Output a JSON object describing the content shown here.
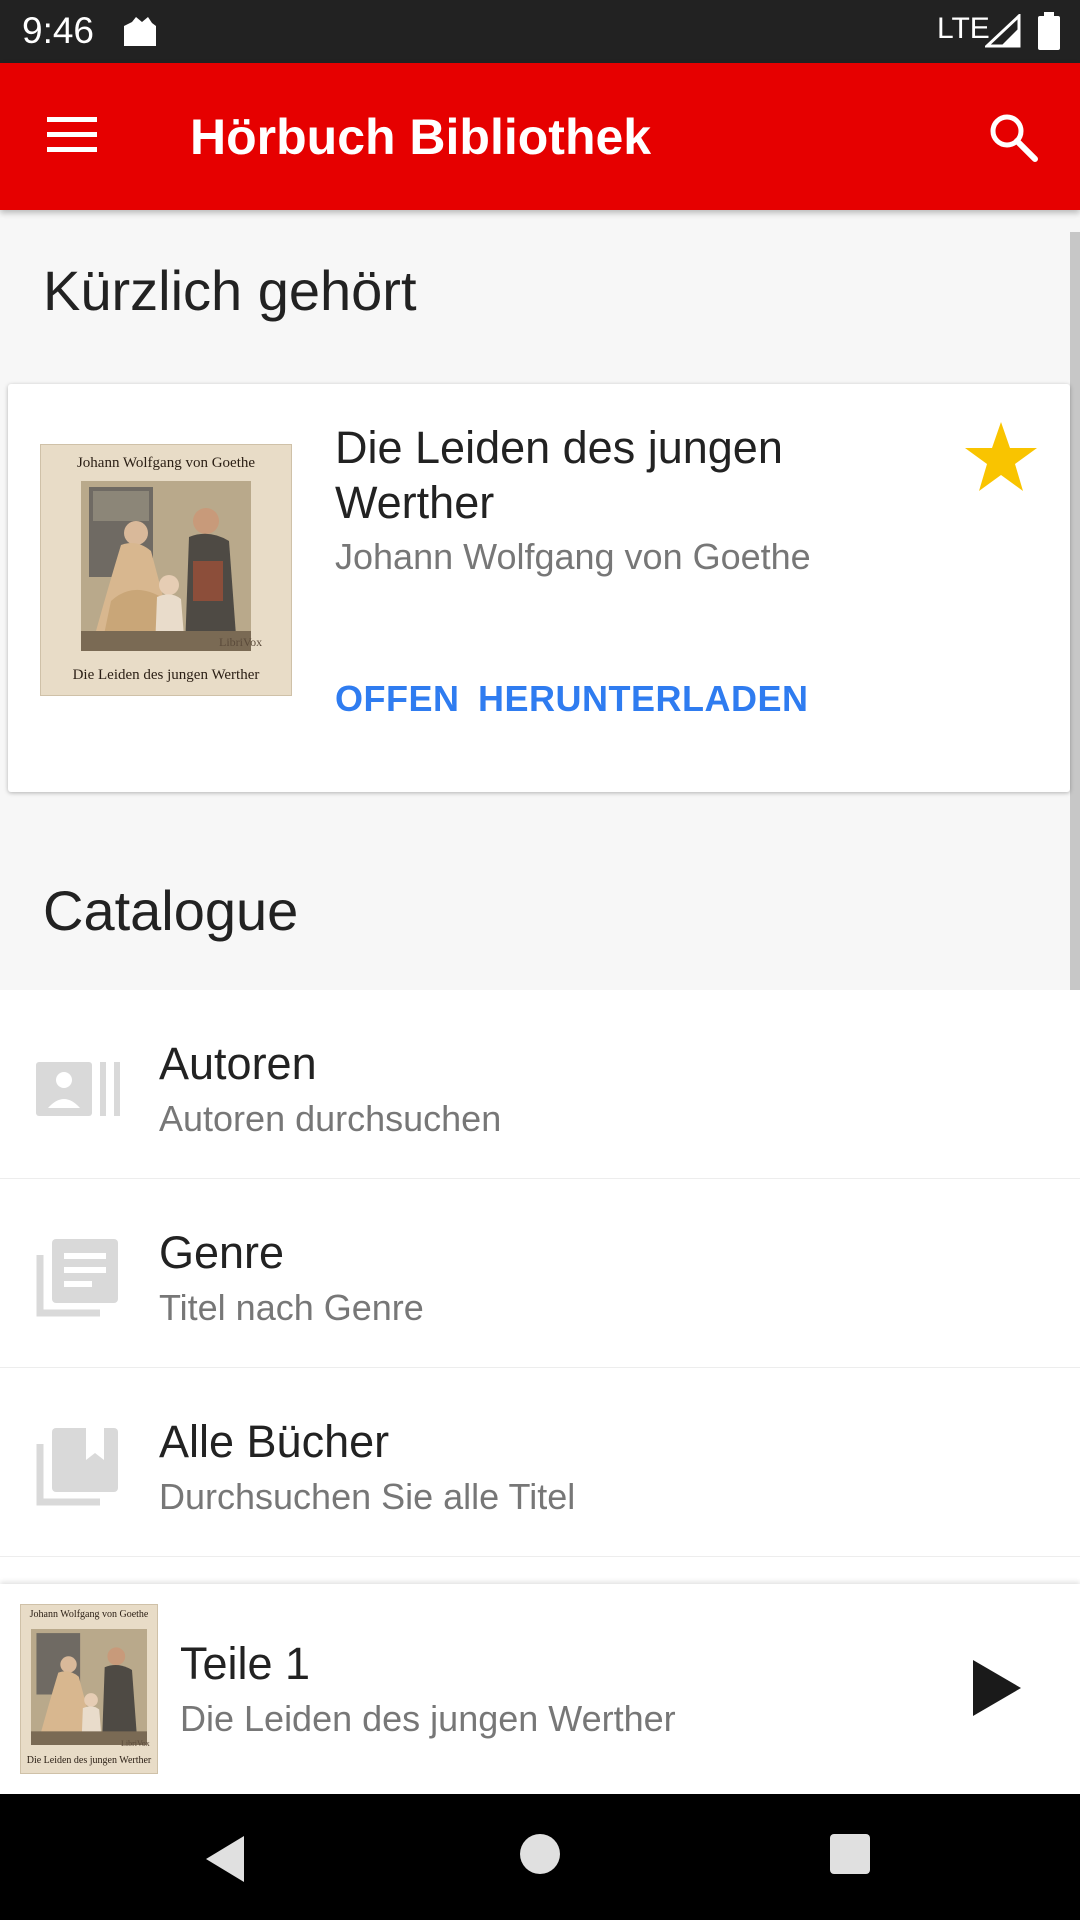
{
  "status_bar": {
    "time": "9:46",
    "network": "LTE",
    "icons": [
      "app-notification-icon",
      "signal-icon",
      "battery-icon"
    ]
  },
  "app_bar": {
    "title": "Hörbuch Bibliothek",
    "icons": [
      "menu-icon",
      "search-icon"
    ],
    "color": "#e60000"
  },
  "recent": {
    "heading": "Kürzlich gehört",
    "book": {
      "title": "Die Leiden des jungen Werther",
      "author": "Johann Wolfgang von Goethe",
      "cover_author": "Johann Wolfgang von Goethe",
      "cover_title": "Die Leiden des jungen Werther",
      "cover_brand": "LibriVox",
      "favorite": true
    },
    "actions": {
      "open": "OFFEN",
      "download": "HERUNTERLADEN"
    },
    "action_color": "#2f7cf0",
    "favorite_color": "#f9c400"
  },
  "catalogue": {
    "heading": "Catalogue",
    "items": [
      {
        "label": "Autoren",
        "subtitle": "Autoren durchsuchen",
        "icon": "author-card-icon"
      },
      {
        "label": "Genre",
        "subtitle": "Titel nach Genre",
        "icon": "genre-library-icon"
      },
      {
        "label": "Alle Bücher",
        "subtitle": "Durchsuchen Sie alle Titel",
        "icon": "all-books-icon"
      }
    ]
  },
  "player": {
    "track": "Teile 1",
    "book": "Die Leiden des jungen Werther",
    "cover_author": "Johann Wolfgang von Goethe",
    "cover_title": "Die Leiden des jungen Werther",
    "cover_brand": "LibriVox",
    "icon": "play-icon"
  },
  "nav_bar": {
    "icons": [
      "back-icon",
      "home-icon",
      "recents-icon"
    ]
  }
}
